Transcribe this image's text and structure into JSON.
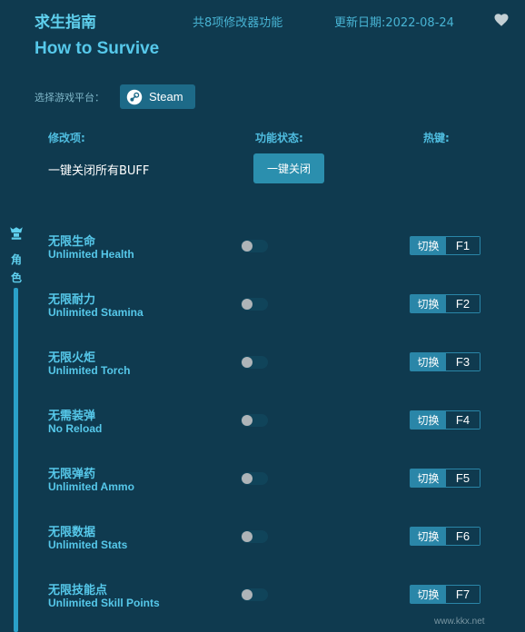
{
  "header": {
    "title": "求生指南",
    "count": "共8项修改器功能",
    "date": "更新日期:2022-08-24",
    "favorite_icon": "heart-icon"
  },
  "subtitle": "How to Survive",
  "platform": {
    "label": "选择游戏平台：",
    "button": "Steam",
    "icon": "steam-icon"
  },
  "columns": {
    "mod": "修改项:",
    "status": "功能状态:",
    "hotkey": "热键:"
  },
  "buff": {
    "label": "一键关闭所有BUFF",
    "button": "一键关闭"
  },
  "category": {
    "icon": "character-icon",
    "label": "角色"
  },
  "switch_label": "切换",
  "cheats": [
    {
      "zh": "无限生命",
      "en": "Unlimited Health",
      "key": "F1",
      "enabled": false
    },
    {
      "zh": "无限耐力",
      "en": "Unlimited Stamina",
      "key": "F2",
      "enabled": false
    },
    {
      "zh": "无限火炬",
      "en": "Unlimited Torch",
      "key": "F3",
      "enabled": false
    },
    {
      "zh": "无需装弹",
      "en": "No Reload",
      "key": "F4",
      "enabled": false
    },
    {
      "zh": "无限弹药",
      "en": "Unlimited Ammo",
      "key": "F5",
      "enabled": false
    },
    {
      "zh": "无限数据",
      "en": "Unlimited Stats",
      "key": "F6",
      "enabled": false
    },
    {
      "zh": "无限技能点",
      "en": "Unlimited Skill Points",
      "key": "F7",
      "enabled": false
    }
  ],
  "watermark": "www.kkx.net",
  "colors": {
    "background": "#0f3a4f",
    "accent": "#56c8ea",
    "button": "#2b8fae"
  }
}
